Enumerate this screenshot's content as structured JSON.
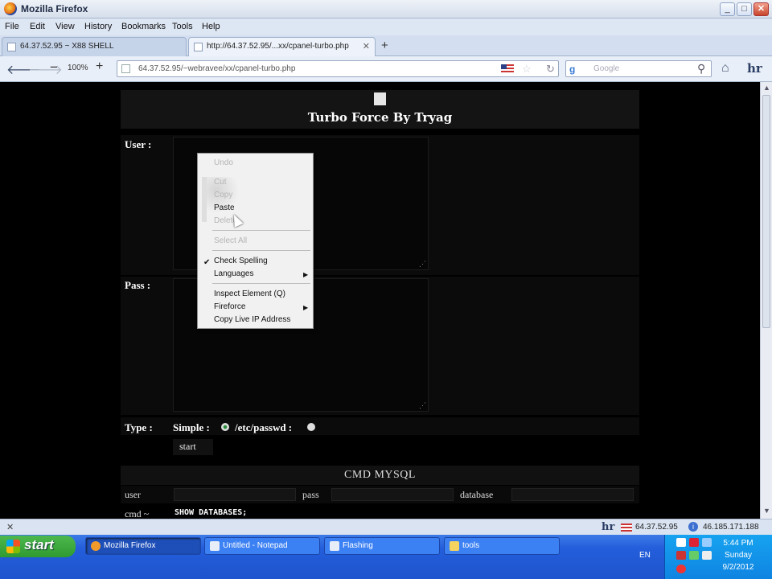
{
  "window": {
    "title": "Mozilla Firefox"
  },
  "menu": [
    "File",
    "Edit",
    "View",
    "History",
    "Bookmarks",
    "Tools",
    "Help"
  ],
  "tabs": [
    {
      "label": "64.37.52.95 ~ X88 SHELL",
      "active": false
    },
    {
      "label": "http://64.37.52.95/...xx/cpanel-turbo.php",
      "active": true
    }
  ],
  "nav": {
    "zoom": "100%",
    "url": "64.37.52.95/~webravee/xx/cpanel-turbo.php",
    "search_engine": "Google"
  },
  "page": {
    "heading": "Turbo Force By Tryag",
    "user_label": "User :",
    "pass_label": "Pass :",
    "type_label": "Type :",
    "simple_label": "Simple :",
    "passwd_label": "/etc/passwd :",
    "start_label": "start",
    "mysql_title": "CMD MYSQL",
    "mysql_user": "user",
    "mysql_pass": "pass",
    "mysql_db": "database",
    "cmd_label": "cmd ~",
    "cmd_value": "SHOW DATABASES;"
  },
  "context_menu": {
    "undo": "Undo",
    "cut": "Cut",
    "copy": "Copy",
    "paste": "Paste",
    "delete": "Delete",
    "select_all": "Select All",
    "check_spelling": "Check Spelling",
    "languages": "Languages",
    "inspect": "Inspect Element (Q)",
    "fireforce": "Fireforce",
    "copy_live_ip": "Copy Live IP Address"
  },
  "statusbar": {
    "ip_local": "64.37.52.95",
    "ip_remote": "46.185.171.188"
  },
  "taskbar": {
    "start": "start",
    "tasks": [
      "Mozilla Firefox",
      "Untitled - Notepad",
      "Flashing",
      "tools"
    ],
    "lang": "EN",
    "time": "5:44 PM",
    "day": "Sunday",
    "date": "9/2/2012"
  },
  "colors": {
    "page_bg": "#000000",
    "taskbar": "#245edb",
    "start_green": "#2f9a2f"
  }
}
